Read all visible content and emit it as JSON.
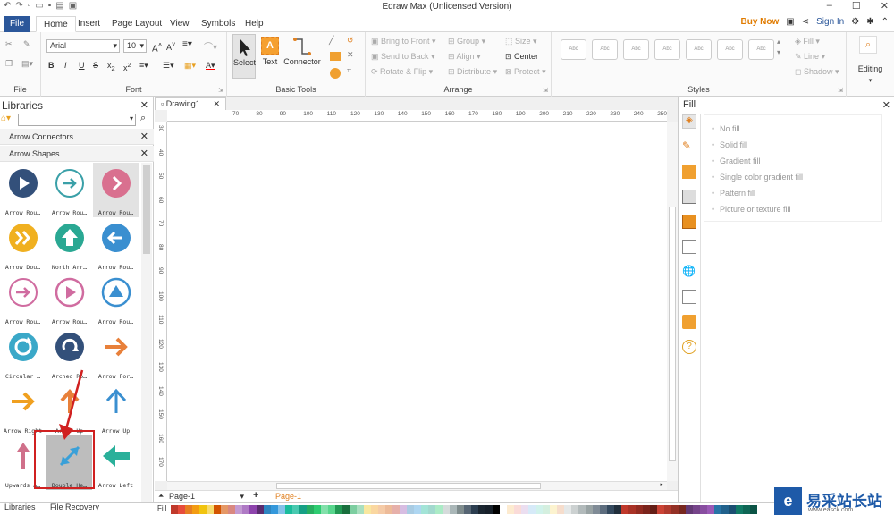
{
  "window": {
    "title": "Edraw Max (Unlicensed Version)"
  },
  "menu_tabs": [
    {
      "label": "File"
    },
    {
      "label": "Home"
    },
    {
      "label": "Insert"
    },
    {
      "label": "Page Layout"
    },
    {
      "label": "View"
    },
    {
      "label": "Symbols"
    },
    {
      "label": "Help"
    }
  ],
  "account": {
    "buy_now": "Buy Now",
    "sign_in": "Sign In"
  },
  "ribbon": {
    "file_group": "File",
    "font": {
      "name": "Arial",
      "size": "10",
      "group": "Font"
    },
    "basic_tools": {
      "select": "Select",
      "text": "Text",
      "connector": "Connector",
      "group": "Basic Tools"
    },
    "arrange": {
      "bring_to_front": "Bring to Front",
      "send_to_back": "Send to Back",
      "rotate_flip": "Rotate & Flip",
      "group_btn": "Group",
      "align": "Align",
      "distribute": "Distribute",
      "size": "Size",
      "center": "Center",
      "protect": "Protect",
      "group": "Arrange"
    },
    "styles": {
      "swatch": "Abc",
      "group": "Styles",
      "fill": "Fill",
      "line": "Line",
      "shadow": "Shadow"
    },
    "editing": "Editing"
  },
  "libraries": {
    "title": "Libraries",
    "categories": [
      "Arrow Connectors",
      "Arrow Shapes"
    ],
    "shapes": [
      {
        "label": "Arrow Rou…",
        "icon": "circle-play-icon",
        "color": "#33507a"
      },
      {
        "label": "Arrow Rou…",
        "icon": "circle-right-arrow-outline-icon",
        "color": "#3aa0a8"
      },
      {
        "label": "Arrow Rou…",
        "icon": "circle-chevron-right-icon",
        "color": "#d9708f"
      },
      {
        "label": "Arrow Dou…",
        "icon": "circle-double-chevron-icon",
        "color": "#f0b020"
      },
      {
        "label": "North Arr…",
        "icon": "circle-up-arrow-icon",
        "color": "#2aa893"
      },
      {
        "label": "Arrow Rou…",
        "icon": "circle-left-arrow-icon",
        "color": "#3a8fd0"
      },
      {
        "label": "Arrow Rou…",
        "icon": "circle-right-arrow-outline-icon",
        "color": "#d06ca0"
      },
      {
        "label": "Arrow Rou…",
        "icon": "circle-play-outline-icon",
        "color": "#d06ca0"
      },
      {
        "label": "Arrow Rou…",
        "icon": "circle-triangle-up-icon",
        "color": "#3a8fd0"
      },
      {
        "label": "Circular …",
        "icon": "circular-arrow-icon",
        "color": "#3aa8c8"
      },
      {
        "label": "Arched Ro…",
        "icon": "arched-arrow-icon",
        "color": "#33507a"
      },
      {
        "label": "Arrow For…",
        "icon": "right-arrow-icon",
        "color": "#e8803a"
      },
      {
        "label": "Arrow Right",
        "icon": "right-arrow-icon",
        "color": "#f0a020"
      },
      {
        "label": "Arrow Up",
        "icon": "up-arrow-icon",
        "color": "#e8803a"
      },
      {
        "label": "Arrow Up",
        "icon": "up-arrow-thin-icon",
        "color": "#3a8fd0"
      },
      {
        "label": "Upwards A…",
        "icon": "thin-up-arrow-icon",
        "color": "#d0708a"
      },
      {
        "label": "Double He…",
        "icon": "double-head-arrow-icon",
        "color": "#3aa0d8"
      },
      {
        "label": "Arrow Left",
        "icon": "left-arrow-icon",
        "color": "#2ab09a"
      }
    ]
  },
  "document": {
    "tab": "Drawing1",
    "page_select": "Page-1",
    "page_tab": "Page-1"
  },
  "rulers": {
    "h_ticks": [
      "70",
      "80",
      "90",
      "100",
      "110",
      "120",
      "130",
      "140",
      "150",
      "160",
      "170",
      "180",
      "190",
      "200",
      "210",
      "220",
      "230",
      "240",
      "250"
    ],
    "v_ticks": [
      "30",
      "40",
      "50",
      "60",
      "70",
      "80",
      "90",
      "100",
      "110",
      "120",
      "130",
      "140",
      "150",
      "160",
      "170"
    ]
  },
  "fill_panel": {
    "title": "Fill",
    "options": [
      "No fill",
      "Solid fill",
      "Gradient fill",
      "Single color gradient fill",
      "Pattern fill",
      "Picture or texture fill"
    ]
  },
  "bottom_tabs": [
    "Libraries",
    "File Recovery"
  ],
  "status": {
    "fill_label": "Fill"
  },
  "watermark": {
    "text": "易采站长站",
    "sub": "www.easck.com"
  },
  "palette": [
    "#c0392b",
    "#e74c3c",
    "#e67e22",
    "#f39c12",
    "#f1c40f",
    "#f7dc6f",
    "#d35400",
    "#e59866",
    "#d98880",
    "#c39bd3",
    "#af7ac5",
    "#8e44ad",
    "#5b2c6f",
    "#2e86c1",
    "#3498db",
    "#85c1e9",
    "#1abc9c",
    "#48c9b0",
    "#16a085",
    "#27ae60",
    "#2ecc71",
    "#82e0aa",
    "#58d68d",
    "#229954",
    "#196f3d",
    "#7dcea0",
    "#a9dfbf",
    "#f9e79f",
    "#fad7a0",
    "#f5cba7",
    "#edbb99",
    "#e6b0aa",
    "#d7bde2",
    "#a9cce3",
    "#aed6f1",
    "#a3e4d7",
    "#a2d9ce",
    "#abebc6",
    "#d5dbdb",
    "#aab7b8",
    "#7f8c8d",
    "#566573",
    "#2c3e50",
    "#1b2631",
    "#17202a",
    "#000000",
    "#ffffff",
    "#fdebd0",
    "#fadbd8",
    "#ebdef0",
    "#d6eaf8",
    "#d1f2eb",
    "#d4efdf",
    "#fcf3cf",
    "#f6ddcc",
    "#e5e8e8",
    "#ccd1d1",
    "#b2babb",
    "#99a3a4",
    "#808b96",
    "#5d6d7e",
    "#34495e",
    "#212f3c",
    "#c0392b",
    "#a93226",
    "#922b21",
    "#7b241c",
    "#641e16",
    "#cb4335",
    "#b03a2e",
    "#943126",
    "#78281f",
    "#633974",
    "#76448a",
    "#884ea0",
    "#9b59b6",
    "#2874a6",
    "#21618c",
    "#1b4f72",
    "#117a65",
    "#0e6655",
    "#0b5345"
  ]
}
